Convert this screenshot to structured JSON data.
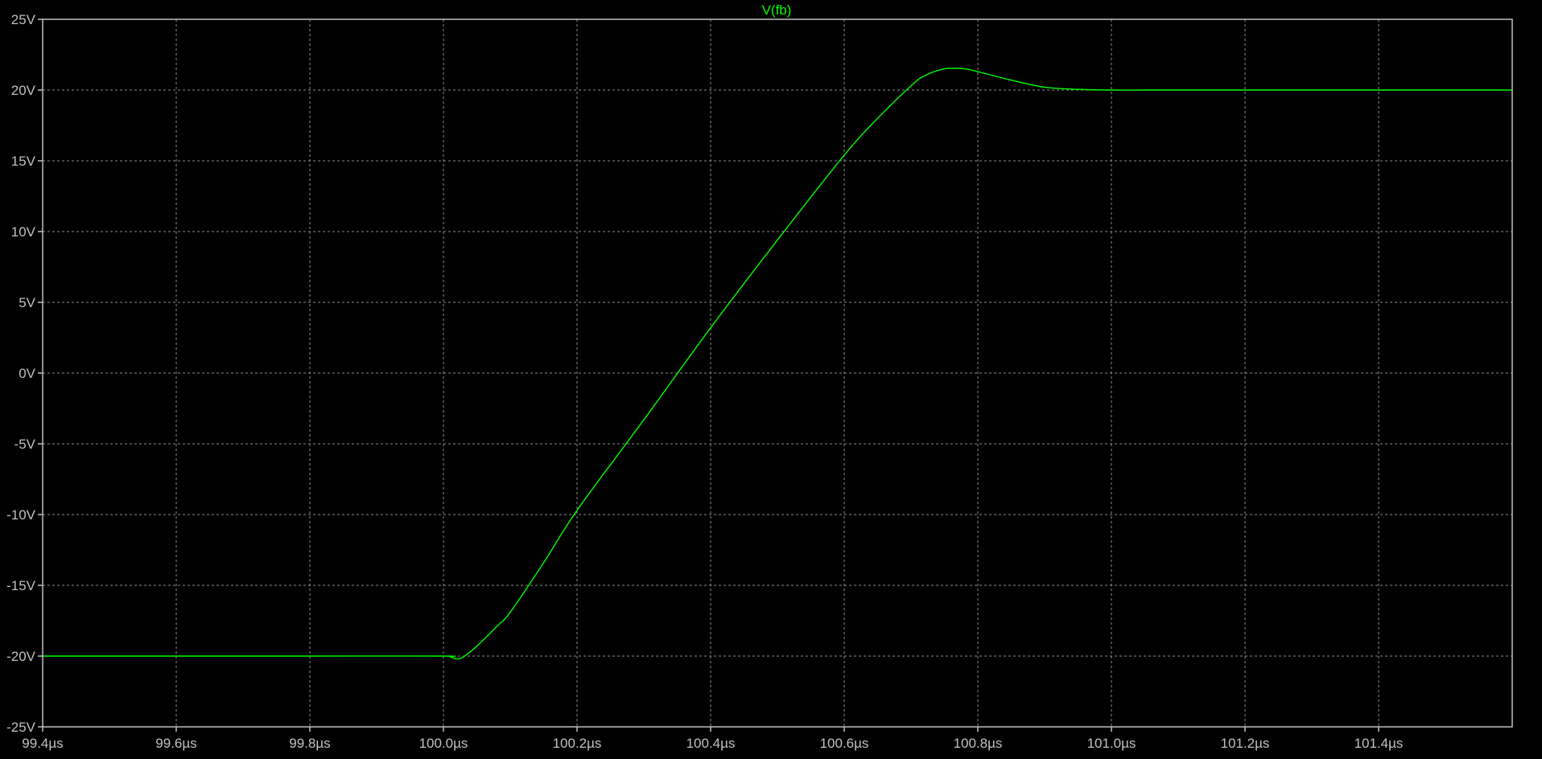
{
  "window": {
    "background": "#000000"
  },
  "chart_data": {
    "type": "line",
    "title": "V(fb)",
    "xlabel": "",
    "ylabel": "",
    "x_unit": "µs",
    "y_unit": "V",
    "xlim": [
      99.4,
      101.6
    ],
    "ylim": [
      -25,
      25
    ],
    "x_ticks": [
      99.4,
      99.6,
      99.8,
      100.0,
      100.2,
      100.4,
      100.6,
      100.8,
      101.0,
      101.2,
      101.4
    ],
    "x_tick_labels": [
      "99.4µs",
      "99.6µs",
      "99.8µs",
      "100.0µs",
      "100.2µs",
      "100.4µs",
      "100.6µs",
      "100.8µs",
      "101.0µs",
      "101.2µs",
      "101.4µs"
    ],
    "y_ticks": [
      25,
      20,
      15,
      10,
      5,
      0,
      -5,
      -10,
      -15,
      -20,
      -25
    ],
    "y_tick_labels": [
      "25V",
      "20V",
      "15V",
      "10V",
      "5V",
      "0V",
      "-5V",
      "-10V",
      "-15V",
      "-20V",
      "-25V"
    ],
    "grid": true,
    "colors": {
      "background": "#000000",
      "frame": "#c0c0c0",
      "grid": "#8c8c8c",
      "tick_text": "#c0c0c0",
      "title": "#00ff00",
      "trace": "#00ff00"
    },
    "series": [
      {
        "name": "V(fb)",
        "color": "#00ff00",
        "x": [
          99.4,
          99.6,
          99.8,
          100.0,
          100.01,
          100.02,
          100.03,
          100.05,
          100.08,
          100.1,
          100.15,
          100.2,
          100.3,
          100.4,
          100.5,
          100.6,
          100.65,
          100.7,
          100.72,
          100.75,
          100.78,
          100.8,
          100.85,
          100.9,
          100.95,
          101.0,
          101.05,
          101.1,
          101.2,
          101.4,
          101.6
        ],
        "y": [
          -20.0,
          -20.0,
          -20.0,
          -20.0,
          -20.05,
          -20.2,
          -20.05,
          -19.3,
          -17.9,
          -16.9,
          -13.4,
          -9.7,
          -3.3,
          3.2,
          9.4,
          15.4,
          18.0,
          20.3,
          21.0,
          21.5,
          21.5,
          21.3,
          20.7,
          20.2,
          20.05,
          20.0,
          20.0,
          20.0,
          20.0,
          20.0,
          20.0
        ]
      }
    ]
  }
}
